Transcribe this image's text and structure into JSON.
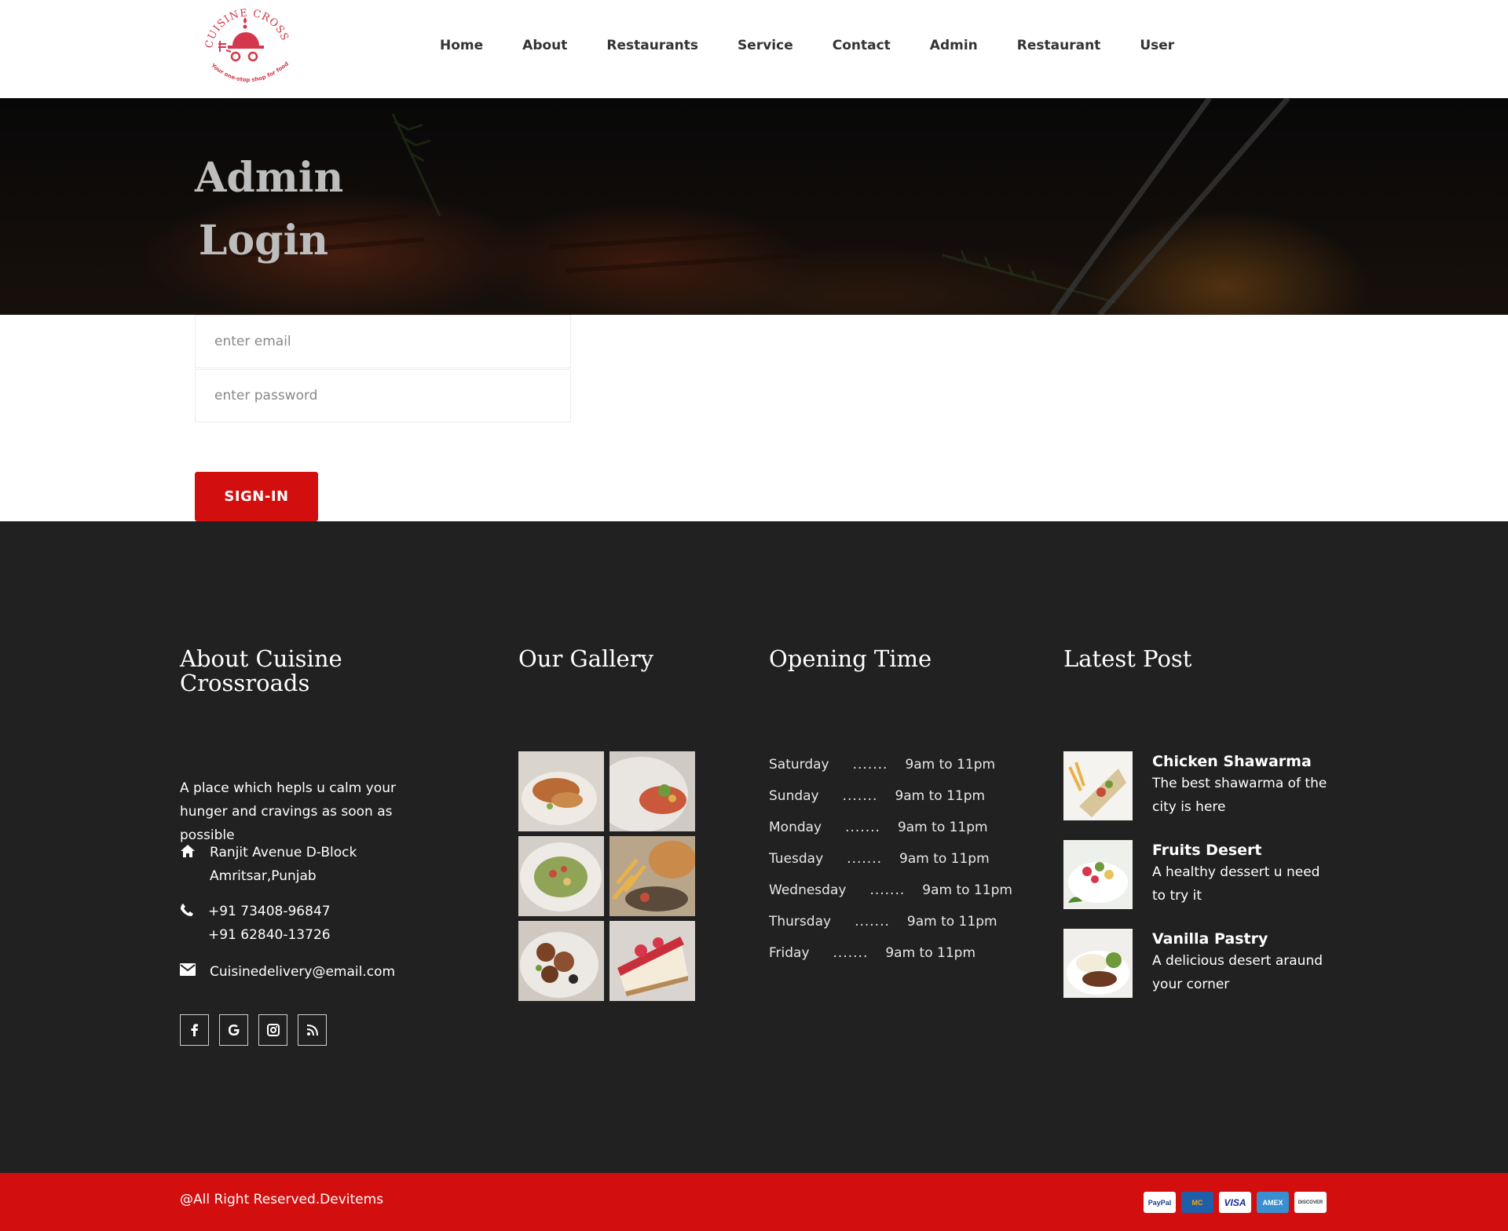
{
  "brand": {
    "logo_text": "CUISINE CROSSROADS",
    "tagline": "Your one-stop shop for food delivery",
    "accent_color": "#d30e0e",
    "logo_color": "#d4374b"
  },
  "nav": {
    "items": [
      "Home",
      "About",
      "Restaurants",
      "Service",
      "Contact",
      "Admin",
      "Restaurant",
      "User"
    ]
  },
  "hero": {
    "title_line1": "Admin",
    "title_line2": "Login"
  },
  "login_form": {
    "email_placeholder": "enter email",
    "password_placeholder": "enter password",
    "signin_label": "SIGN-IN"
  },
  "footer": {
    "about": {
      "heading": "About Cuisine Crossroads",
      "description": "A place which hepls u calm your hunger and cravings as soon as possible",
      "address_line1": "Ranjit Avenue D-Block",
      "address_line2": "Amritsar,Punjab",
      "phone1": "+91 73408-96847",
      "phone2": "+91 62840-13726",
      "email": "Cuisinedelivery@email.com",
      "social_icons": [
        "facebook-icon",
        "google-icon",
        "instagram-icon",
        "rss-icon"
      ]
    },
    "gallery": {
      "heading": "Our Gallery",
      "tiles": [
        "grilled-chicken-dish",
        "salad-plate",
        "pasta-salad",
        "burger-fries",
        "meat-skewers",
        "strawberry-cheesecake"
      ]
    },
    "opening": {
      "heading": "Opening Time",
      "hours": [
        {
          "day": "Saturday",
          "dots": ".......",
          "time": "9am to 11pm"
        },
        {
          "day": "Sunday",
          "dots": ".......",
          "time": "9am to 11pm"
        },
        {
          "day": "Monday",
          "dots": ".......",
          "time": "9am to 11pm"
        },
        {
          "day": "Tuesday",
          "dots": ".......",
          "time": "9am to 11pm"
        },
        {
          "day": "Wednesday",
          "dots": ".......",
          "time": "9am to 11pm"
        },
        {
          "day": "Thursday",
          "dots": ".......",
          "time": "9am to 11pm"
        },
        {
          "day": "Friday",
          "dots": ".......",
          "time": "9am to 11pm"
        }
      ]
    },
    "latest": {
      "heading": "Latest Post",
      "posts": [
        {
          "title": "Chicken Shawarma",
          "desc": "The best shawarma of the city is here"
        },
        {
          "title": "Fruits Desert",
          "desc": "A healthy dessert u need to try it"
        },
        {
          "title": "Vanilla Pastry",
          "desc": "A delicious desert araund your corner"
        }
      ]
    }
  },
  "bottom": {
    "copyright": "@All Right Reserved.Devitems",
    "payments": [
      "PayPal",
      "MC",
      "VISA",
      "AMEX",
      "DISCOVER"
    ]
  }
}
